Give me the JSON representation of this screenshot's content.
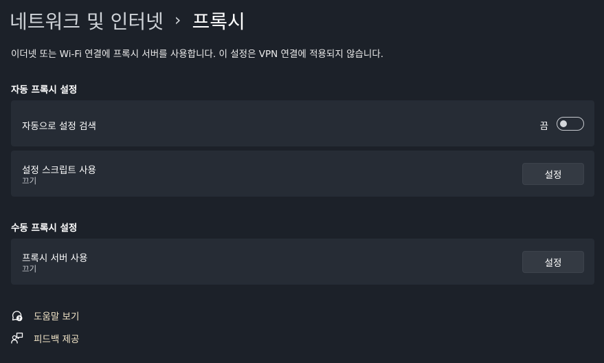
{
  "breadcrumb": {
    "parent": "네트워크 및 인터넷",
    "separator": "›",
    "current": "프록시"
  },
  "description": "이더넷 또는 Wi-Fi 연결에 프록시 서버를 사용합니다. 이 설정은 VPN 연결에 적용되지 않습니다.",
  "auto_section": {
    "title": "자동 프록시 설정",
    "detect": {
      "label": "자동으로 설정 검색",
      "toggle_state_label": "끔",
      "toggle_on": false
    },
    "script": {
      "label": "설정 스크립트 사용",
      "status": "끄기",
      "button_label": "설정"
    }
  },
  "manual_section": {
    "title": "수동 프록시 설정",
    "proxy_server": {
      "label": "프록시 서버 사용",
      "status": "끄기",
      "button_label": "설정"
    }
  },
  "links": {
    "help": "도움말 보기",
    "feedback": "피드백 제공"
  },
  "colors": {
    "background": "#1c2129",
    "card": "#262c35",
    "button": "#343a43",
    "link_text": "#f2e5c8"
  },
  "icons": {
    "help": "help-chat-icon",
    "feedback": "feedback-icon"
  }
}
